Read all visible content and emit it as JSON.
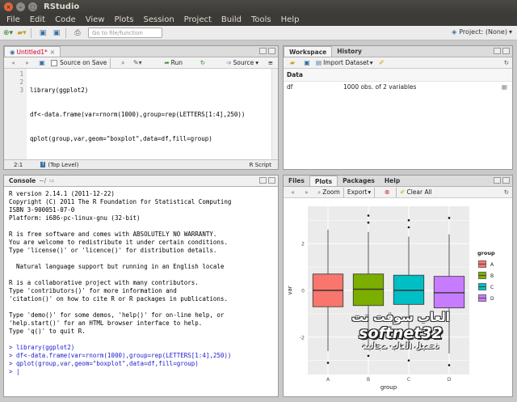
{
  "window": {
    "title": "RStudio"
  },
  "menu": [
    "File",
    "Edit",
    "Code",
    "View",
    "Plots",
    "Session",
    "Project",
    "Build",
    "Tools",
    "Help"
  ],
  "toolbar": {
    "goto_placeholder": "Go to file/function",
    "project_label": "Project: (None)"
  },
  "source": {
    "tab_label": "Untitled1*",
    "source_on_save": "Source on Save",
    "run_label": "Run",
    "source_label": "Source",
    "lines": [
      "library(ggplot2)",
      "df<-data.frame(var=rnorm(1000),group=rep(LETTERS[1:4],250))",
      "qplot(group,var,geom=\"boxplot\",data=df,fill=group)"
    ],
    "line_numbers": [
      "1",
      "2",
      "3"
    ],
    "cursor_pos": "2:1",
    "scope": "(Top Level)",
    "filetype": "R Script"
  },
  "console": {
    "tab_label": "Console",
    "path": "~/",
    "lines": [
      "R version 2.14.1 (2011-12-22)",
      "Copyright (C) 2011 The R Foundation for Statistical Computing",
      "ISBN 3-900051-07-0",
      "Platform: i686-pc-linux-gnu (32-bit)",
      "",
      "R is free software and comes with ABSOLUTELY NO WARRANTY.",
      "You are welcome to redistribute it under certain conditions.",
      "Type 'license()' or 'licence()' for distribution details.",
      "",
      "  Natural language support but running in an English locale",
      "",
      "R is a collaborative project with many contributors.",
      "Type 'contributors()' for more information and",
      "'citation()' on how to cite R or R packages in publications.",
      "",
      "Type 'demo()' for some demos, 'help()' for on-line help, or",
      "'help.start()' for an HTML browser interface to help.",
      "Type 'q()' to quit R."
    ],
    "commands": [
      "> library(ggplot2)",
      "> df<-data.frame(var=rnorm(1000),group=rep(LETTERS[1:4],250))",
      "> qplot(group,var,geom=\"boxplot\",data=df,fill=group)",
      "> |"
    ]
  },
  "workspace": {
    "tabs": [
      "Workspace",
      "History"
    ],
    "import_label": "Import Dataset",
    "section": "Data",
    "rows": [
      {
        "name": "df",
        "desc": "1000 obs. of 2 variables"
      }
    ]
  },
  "plots": {
    "tabs": [
      "Files",
      "Plots",
      "Packages",
      "Help"
    ],
    "zoom_label": "Zoom",
    "export_label": "Export",
    "clear_label": "Clear All"
  },
  "chart_data": {
    "type": "boxplot",
    "categories": [
      "A",
      "B",
      "C",
      "D"
    ],
    "fills": [
      "#f8766d",
      "#7cae00",
      "#00bfc4",
      "#c77cff"
    ],
    "boxes": [
      {
        "q1": -0.7,
        "median": 0.0,
        "q3": 0.7,
        "low": -2.6,
        "high": 2.6,
        "outliers": [
          -3.1
        ]
      },
      {
        "q1": -0.65,
        "median": 0.05,
        "q3": 0.7,
        "low": -2.4,
        "high": 2.5,
        "outliers": [
          3.2,
          2.9,
          -2.8
        ]
      },
      {
        "q1": -0.6,
        "median": 0.0,
        "q3": 0.65,
        "low": -2.5,
        "high": 2.3,
        "outliers": [
          3.0,
          2.7,
          -3.0
        ]
      },
      {
        "q1": -0.75,
        "median": -0.1,
        "q3": 0.6,
        "low": -2.7,
        "high": 2.4,
        "outliers": [
          3.1,
          -3.2
        ]
      }
    ],
    "ylim": [
      -3.6,
      3.6
    ],
    "yticks": [
      -2,
      0,
      2
    ],
    "xlabel": "group",
    "ylabel": "var",
    "legend_title": "group",
    "legend_position": "right",
    "grid": true
  },
  "watermark": {
    "line1": "العاب سوفت نت",
    "line2": "softnet32",
    "line3": "تحميل العاب مجانية"
  }
}
